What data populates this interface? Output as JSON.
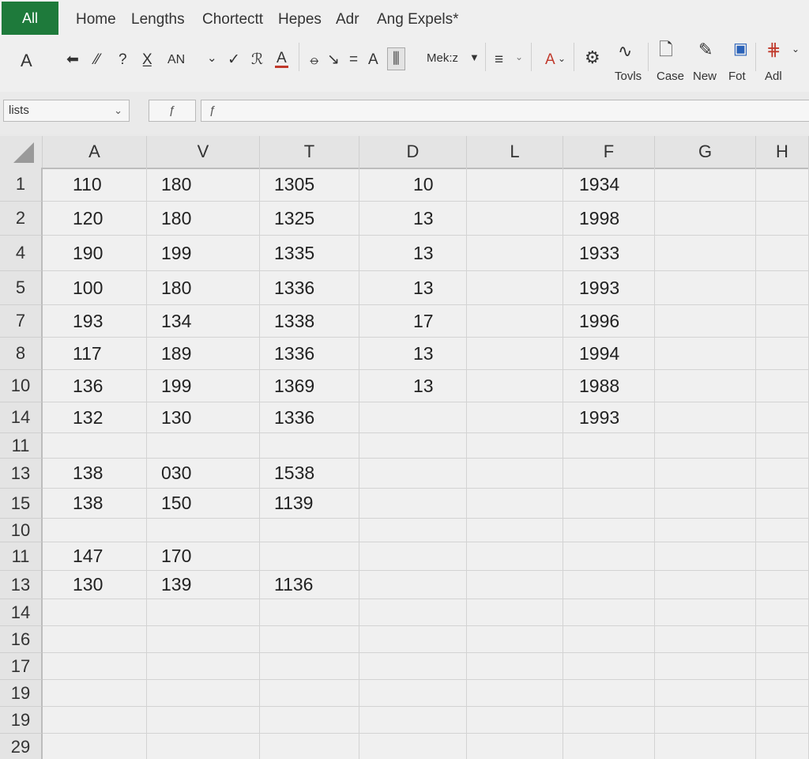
{
  "tabs": {
    "file": "All",
    "items": [
      "Home",
      "Lengths",
      "Chortectt",
      "Hepes",
      "Adr",
      "Ang Expels*"
    ]
  },
  "toolbar": {
    "font_a": "A",
    "glyphs": [
      "⬅",
      "⁄⁄",
      "?",
      "X̲",
      "AN",
      "⌄",
      "✓",
      "ℛ",
      "A",
      "⦵",
      "↘",
      "=",
      "A",
      "⫼"
    ],
    "style_box": "Mek:z",
    "align": "≡",
    "font_color": "A",
    "labels": {
      "tools": "Tovls",
      "case": "Case",
      "new": "New",
      "fot": "Fot",
      "adl": "Adl"
    }
  },
  "formula_bar": {
    "name_box": "lists",
    "fx": "ƒ",
    "formula_prefix": "ƒ"
  },
  "accent": {
    "file_tab": "#1e7a3b",
    "underline_red": "#c0392b"
  },
  "grid": {
    "columns": [
      "A",
      "V",
      "T",
      "D",
      "L",
      "F",
      "G",
      "H"
    ],
    "rows": [
      {
        "num": "1",
        "cells": [
          "110",
          "180",
          "1305",
          "10",
          "",
          "1934",
          "",
          ""
        ]
      },
      {
        "num": "2",
        "cells": [
          "120",
          "180",
          "1325",
          "13",
          "",
          "1998",
          "",
          ""
        ]
      },
      {
        "num": "4",
        "cells": [
          "190",
          "199",
          "1335",
          "13",
          "",
          "1933",
          "",
          ""
        ]
      },
      {
        "num": "5",
        "cells": [
          "100",
          "180",
          "1336",
          "13",
          "",
          "1993",
          "",
          ""
        ]
      },
      {
        "num": "7",
        "cells": [
          "193",
          "134",
          "1338",
          "17",
          "",
          "1996",
          "",
          ""
        ]
      },
      {
        "num": "8",
        "cells": [
          "117",
          "189",
          "1336",
          "13",
          "",
          "1994",
          "",
          ""
        ]
      },
      {
        "num": "10",
        "cells": [
          "136",
          "199",
          "1369",
          "13",
          "",
          "1988",
          "",
          ""
        ]
      },
      {
        "num": "14",
        "cells": [
          "132",
          "130",
          "1336",
          "",
          "",
          "1993",
          "",
          ""
        ]
      },
      {
        "num": "11",
        "cells": [
          "",
          "",
          "",
          "",
          "",
          "",
          "",
          ""
        ]
      },
      {
        "num": "13",
        "cells": [
          "138",
          "030",
          "1538",
          "",
          "",
          "",
          "",
          ""
        ]
      },
      {
        "num": "15",
        "cells": [
          "138",
          "150",
          "1139",
          "",
          "",
          "",
          "",
          ""
        ]
      },
      {
        "num": "10",
        "cells": [
          "",
          "",
          "",
          "",
          "",
          "",
          "",
          ""
        ]
      },
      {
        "num": "11",
        "cells": [
          "147",
          "170",
          "",
          "",
          "",
          "",
          "",
          ""
        ]
      },
      {
        "num": "13",
        "cells": [
          "130",
          "139",
          "1136",
          "",
          "",
          "",
          "",
          ""
        ]
      },
      {
        "num": "14",
        "cells": [
          "",
          "",
          "",
          "",
          "",
          "",
          "",
          ""
        ]
      },
      {
        "num": "16",
        "cells": [
          "",
          "",
          "",
          "",
          "",
          "",
          "",
          ""
        ]
      },
      {
        "num": "17",
        "cells": [
          "",
          "",
          "",
          "",
          "",
          "",
          "",
          ""
        ]
      },
      {
        "num": "19",
        "cells": [
          "",
          "",
          "",
          "",
          "",
          "",
          "",
          ""
        ]
      },
      {
        "num": "19",
        "cells": [
          "",
          "",
          "",
          "",
          "",
          "",
          "",
          ""
        ]
      },
      {
        "num": "29",
        "cells": [
          "",
          "",
          "",
          "",
          "",
          "",
          "",
          ""
        ]
      }
    ]
  }
}
